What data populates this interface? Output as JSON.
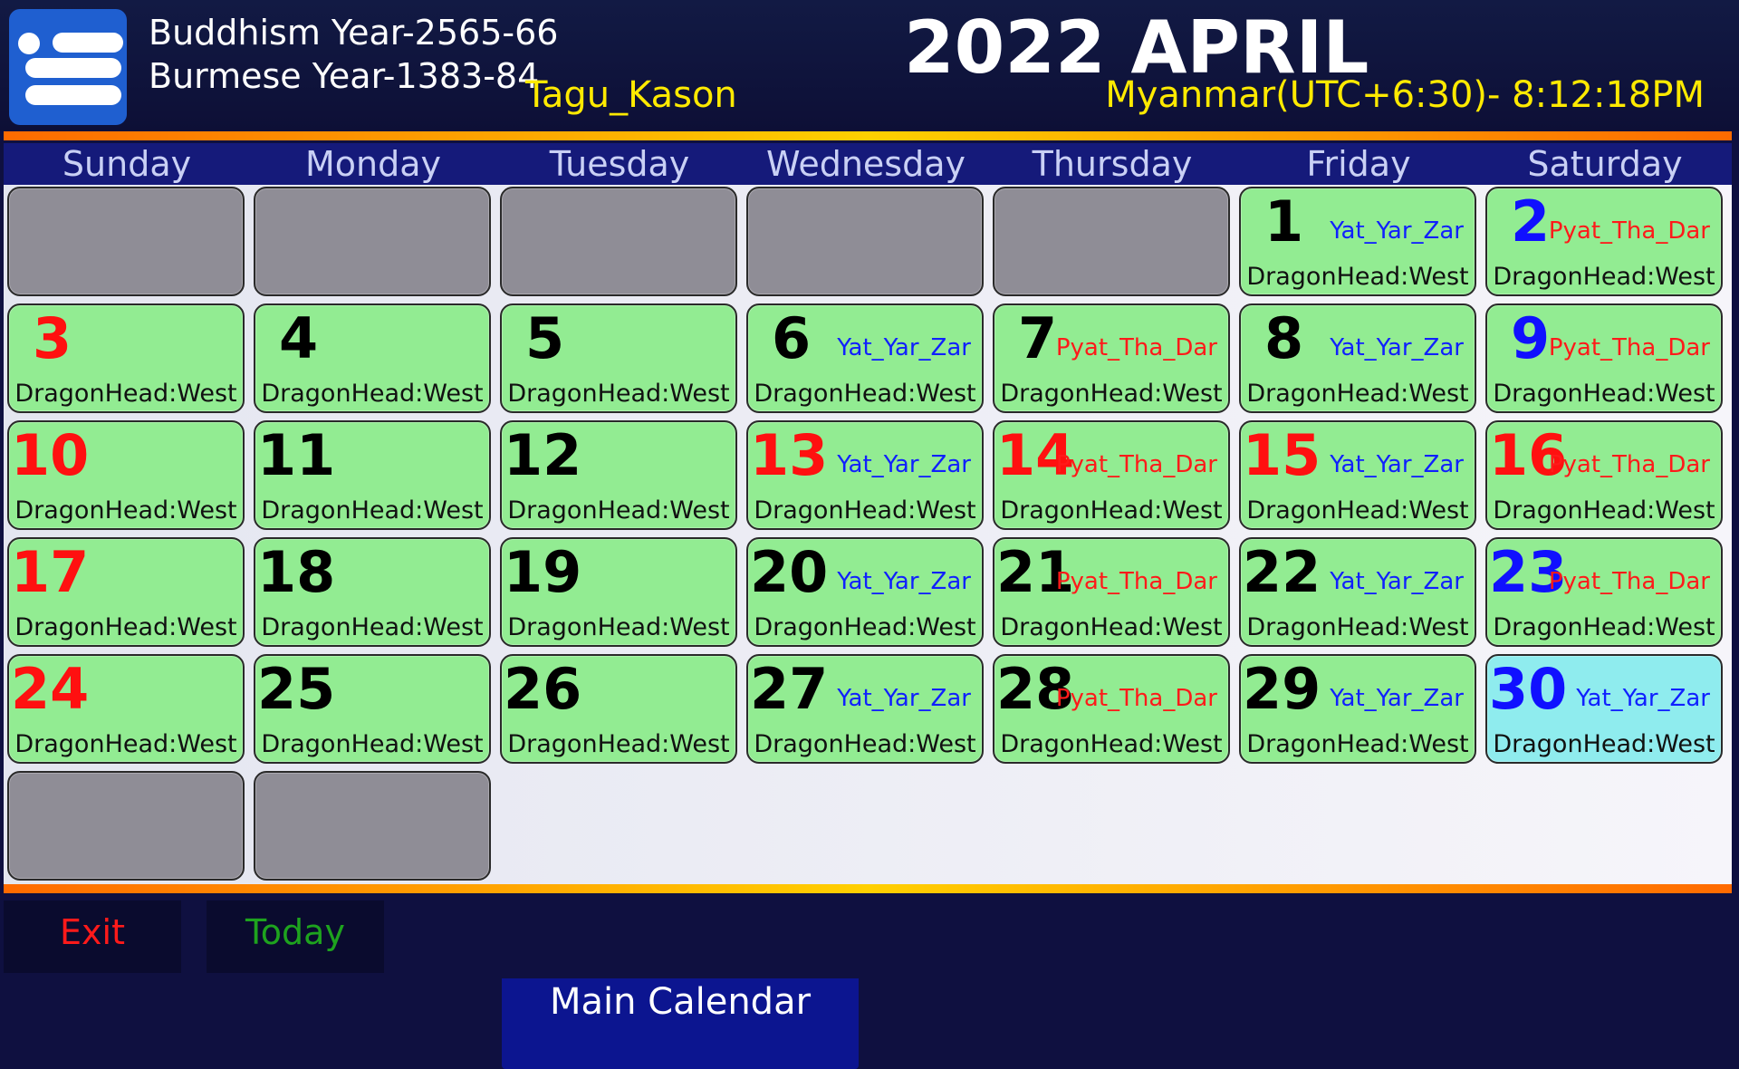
{
  "header": {
    "buddhism_year": "Buddhism Year-2565-66",
    "burmese_year": "Burmese Year-1383-84",
    "season": "Tagu_Kason",
    "title": "2022 APRIL",
    "clock": "Myanmar(UTC+6:30)- 8:12:18PM",
    "menu_icon": "hamburger-menu-icon"
  },
  "weekdays": [
    "Sunday",
    "Monday",
    "Tuesday",
    "Wednesday",
    "Thursday",
    "Friday",
    "Saturday"
  ],
  "dragon_text": "DragonHead:West",
  "cells": [
    {
      "day": "",
      "tag": "",
      "day_color": "",
      "tag_color": "",
      "empty": true
    },
    {
      "day": "",
      "tag": "",
      "day_color": "",
      "tag_color": "",
      "empty": true
    },
    {
      "day": "",
      "tag": "",
      "day_color": "",
      "tag_color": "",
      "empty": true
    },
    {
      "day": "",
      "tag": "",
      "day_color": "",
      "tag_color": "",
      "empty": true
    },
    {
      "day": "",
      "tag": "",
      "day_color": "",
      "tag_color": "",
      "empty": true
    },
    {
      "day": "1",
      "tag": "Yat_Yar_Zar",
      "day_color": "black",
      "tag_color": "blue"
    },
    {
      "day": "2",
      "tag": "Pyat_Tha_Dar",
      "day_color": "blue",
      "tag_color": "red"
    },
    {
      "day": "3",
      "tag": "",
      "day_color": "red",
      "tag_color": ""
    },
    {
      "day": "4",
      "tag": "",
      "day_color": "black",
      "tag_color": ""
    },
    {
      "day": "5",
      "tag": "",
      "day_color": "black",
      "tag_color": ""
    },
    {
      "day": "6",
      "tag": "Yat_Yar_Zar",
      "day_color": "black",
      "tag_color": "blue"
    },
    {
      "day": "7",
      "tag": "Pyat_Tha_Dar",
      "day_color": "black",
      "tag_color": "red"
    },
    {
      "day": "8",
      "tag": "Yat_Yar_Zar",
      "day_color": "black",
      "tag_color": "blue"
    },
    {
      "day": "9",
      "tag": "Pyat_Tha_Dar",
      "day_color": "blue",
      "tag_color": "red"
    },
    {
      "day": "10",
      "tag": "",
      "day_color": "red",
      "tag_color": ""
    },
    {
      "day": "11",
      "tag": "",
      "day_color": "black",
      "tag_color": ""
    },
    {
      "day": "12",
      "tag": "",
      "day_color": "black",
      "tag_color": ""
    },
    {
      "day": "13",
      "tag": "Yat_Yar_Zar",
      "day_color": "red",
      "tag_color": "blue"
    },
    {
      "day": "14",
      "tag": "Pyat_Tha_Dar",
      "day_color": "red",
      "tag_color": "red"
    },
    {
      "day": "15",
      "tag": "Yat_Yar_Zar",
      "day_color": "red",
      "tag_color": "blue"
    },
    {
      "day": "16",
      "tag": "Pyat_Tha_Dar",
      "day_color": "red",
      "tag_color": "red"
    },
    {
      "day": "17",
      "tag": "",
      "day_color": "red",
      "tag_color": ""
    },
    {
      "day": "18",
      "tag": "",
      "day_color": "black",
      "tag_color": ""
    },
    {
      "day": "19",
      "tag": "",
      "day_color": "black",
      "tag_color": ""
    },
    {
      "day": "20",
      "tag": "Yat_Yar_Zar",
      "day_color": "black",
      "tag_color": "blue"
    },
    {
      "day": "21",
      "tag": "Pyat_Tha_Dar",
      "day_color": "black",
      "tag_color": "red"
    },
    {
      "day": "22",
      "tag": "Yat_Yar_Zar",
      "day_color": "black",
      "tag_color": "blue"
    },
    {
      "day": "23",
      "tag": "Pyat_Tha_Dar",
      "day_color": "blue",
      "tag_color": "red"
    },
    {
      "day": "24",
      "tag": "",
      "day_color": "red",
      "tag_color": ""
    },
    {
      "day": "25",
      "tag": "",
      "day_color": "black",
      "tag_color": ""
    },
    {
      "day": "26",
      "tag": "",
      "day_color": "black",
      "tag_color": ""
    },
    {
      "day": "27",
      "tag": "Yat_Yar_Zar",
      "day_color": "black",
      "tag_color": "blue"
    },
    {
      "day": "28",
      "tag": "Pyat_Tha_Dar",
      "day_color": "black",
      "tag_color": "red"
    },
    {
      "day": "29",
      "tag": "Yat_Yar_Zar",
      "day_color": "black",
      "tag_color": "blue"
    },
    {
      "day": "30",
      "tag": "Yat_Yar_Zar",
      "day_color": "blue",
      "tag_color": "blue",
      "today": true
    },
    {
      "day": "",
      "tag": "",
      "day_color": "",
      "tag_color": "",
      "empty": true
    },
    {
      "day": "",
      "tag": "",
      "day_color": "",
      "tag_color": "",
      "empty": true
    }
  ],
  "main_calendar_button": "Main Calendar",
  "footer": {
    "exit_label": "Exit",
    "today_label": "Today"
  },
  "colors": {
    "background": "#0f1040",
    "cell_green": "#92ec92",
    "cell_empty": "#8f8d96",
    "cell_today": "#8fecee",
    "weekday_bar": "#151a7a",
    "accent_yellow": "#ffea00",
    "exit_red": "#ff1a1a",
    "today_green": "#1ea31e",
    "button_blue": "#0c1590"
  }
}
